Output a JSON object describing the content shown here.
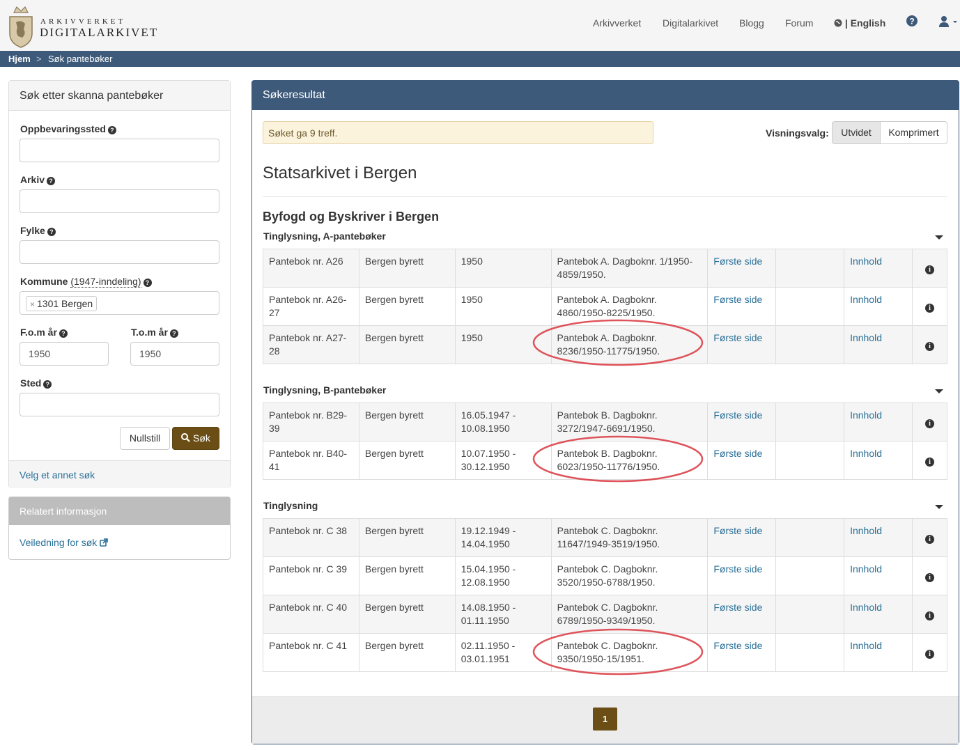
{
  "header": {
    "brand_top": "ARKIVVERKET",
    "brand_bottom": "DIGITALARKIVET",
    "nav": [
      "Arkivverket",
      "Digitalarkivet",
      "Blogg",
      "Forum"
    ],
    "language": "| English"
  },
  "breadcrumb": {
    "home": "Hjem",
    "sep": ">",
    "current": "Søk pantebøker"
  },
  "search_panel": {
    "title": "Søk etter skanna pantebøker",
    "fields": {
      "oppbevaringssted": {
        "label": "Oppbevaringssted",
        "value": ""
      },
      "arkiv": {
        "label": "Arkiv",
        "value": ""
      },
      "fylke": {
        "label": "Fylke",
        "value": ""
      },
      "kommune": {
        "label": "Kommune",
        "sublabel": "(1947-inndeling)",
        "tag": "1301 Bergen"
      },
      "fom": {
        "label": "F.o.m år",
        "value": "1950"
      },
      "tom": {
        "label": "T.o.m år",
        "value": "1950"
      },
      "sted": {
        "label": "Sted",
        "value": ""
      }
    },
    "reset_label": "Nullstill",
    "search_label": "Søk",
    "other_search_link": "Velg et annet søk"
  },
  "related": {
    "title": "Relatert informasjon",
    "link": "Veiledning for søk"
  },
  "results": {
    "title": "Søkeresultat",
    "hits_text": "Søket ga 9 treff.",
    "view_label": "Visningsvalg:",
    "view_options": [
      "Utvidet",
      "Komprimert"
    ],
    "archive": "Statsarkivet i Bergen",
    "creator": "Byfogd og Byskriver i Bergen",
    "link_first": "Første side",
    "link_content": "Innhold",
    "groups": [
      {
        "name": "Tinglysning, A-pantebøker",
        "rows": [
          {
            "title": "Pantebok nr. A26",
            "court": "Bergen byrett",
            "period": "1950",
            "desc": "Pantebok A. Dagboknr. 1/1950-4859/1950."
          },
          {
            "title": "Pantebok nr. A26-27",
            "court": "Bergen byrett",
            "period": "1950",
            "desc": "Pantebok A. Dagboknr. 4860/1950-8225/1950."
          },
          {
            "title": "Pantebok nr. A27-28",
            "court": "Bergen byrett",
            "period": "1950",
            "desc": "Pantebok A. Dagboknr. 8236/1950-11775/1950."
          }
        ]
      },
      {
        "name": "Tinglysning, B-pantebøker",
        "rows": [
          {
            "title": "Pantebok nr. B29-39",
            "court": "Bergen byrett",
            "period": "16.05.1947 - 10.08.1950",
            "desc": "Pantebok B. Dagboknr. 3272/1947-6691/1950."
          },
          {
            "title": "Pantebok nr. B40-41",
            "court": "Bergen byrett",
            "period": "10.07.1950 - 30.12.1950",
            "desc": "Pantebok B. Dagboknr. 6023/1950-11776/1950."
          }
        ]
      },
      {
        "name": "Tinglysning",
        "rows": [
          {
            "title": "Pantebok nr. C 38",
            "court": "Bergen byrett",
            "period": "19.12.1949 - 14.04.1950",
            "desc": "Pantebok C. Dagboknr. 11647/1949-3519/1950."
          },
          {
            "title": "Pantebok nr. C 39",
            "court": "Bergen byrett",
            "period": "15.04.1950 - 12.08.1950",
            "desc": "Pantebok C. Dagboknr. 3520/1950-6788/1950."
          },
          {
            "title": "Pantebok nr. C 40",
            "court": "Bergen byrett",
            "period": "14.08.1950 - 01.11.1950",
            "desc": "Pantebok C. Dagboknr. 6789/1950-9349/1950."
          },
          {
            "title": "Pantebok nr. C 41",
            "court": "Bergen byrett",
            "period": "02.11.1950 - 03.01.1951",
            "desc": "Pantebok C. Dagboknr. 9350/1950-15/1951."
          }
        ]
      }
    ],
    "page": "1"
  },
  "colors": {
    "navy": "#3e5a7a",
    "brown": "#6b4e15",
    "link": "#2a6f97",
    "annotation": "#d9363e"
  }
}
